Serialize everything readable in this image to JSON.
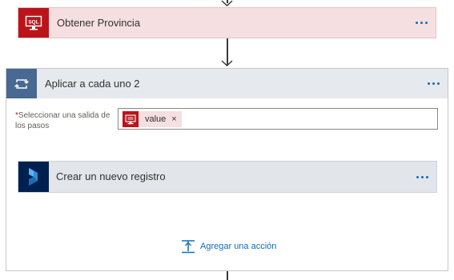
{
  "sql_step": {
    "title": "Obtener Provincia",
    "icon": "sql-server-icon",
    "color": "#ba141a"
  },
  "foreach_step": {
    "title": "Aplicar a cada uno 2",
    "icon": "loop-icon",
    "color": "#486991",
    "field": {
      "required_marker": "*",
      "label": "Seleccionar una salida de los pasos",
      "token": {
        "label": "value",
        "close": "×",
        "icon": "sql-server-icon"
      }
    }
  },
  "dynamics_step": {
    "title": "Crear un nuevo registro",
    "icon": "dynamics-icon",
    "color": "#002050"
  },
  "add_action": {
    "label": "Agregar una acción",
    "icon": "insert-step-icon"
  },
  "accent": "#0f6cbd"
}
